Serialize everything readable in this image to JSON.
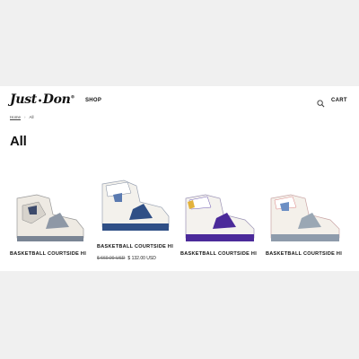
{
  "header": {
    "logo": {
      "text_left": "Just",
      "sep": "•",
      "text_right": "Don",
      "mark": "®"
    },
    "nav": {
      "shop": "SHOP"
    },
    "search_icon": "search-icon",
    "cart": "CART"
  },
  "breadcrumb": {
    "home": "Home",
    "separator": "›",
    "current": "All"
  },
  "page_title": "All",
  "colors": {
    "accent": "#111111",
    "background": "#ffffff"
  },
  "products": [
    {
      "name": "BASKETBALL COURTSIDE HI",
      "price_old": "",
      "price_new": "",
      "accent": "#6f7b8a"
    },
    {
      "name": "BASKETBALL COURTSIDE HI",
      "price_old": "$ 660.00 USD",
      "price_new": "$ 132.00 USD",
      "accent": "#2f4f86"
    },
    {
      "name": "BASKETBALL COURTSIDE HI",
      "price_old": "",
      "price_new": "",
      "accent": "#4b2a9a"
    },
    {
      "name": "BASKETBALL COURTSIDE HI",
      "price_old": "",
      "price_new": "",
      "accent": "#d98080"
    }
  ]
}
